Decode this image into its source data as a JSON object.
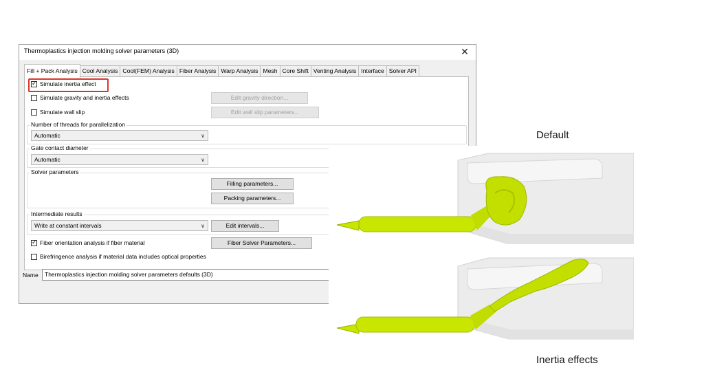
{
  "dialog": {
    "title": "Thermoplastics injection molding solver parameters (3D)",
    "close_glyph": "✕",
    "tabs": [
      "Fill + Pack Analysis",
      "Cool Analysis",
      "Cool(FEM) Analysis",
      "Fiber Analysis",
      "Warp Analysis",
      "Mesh",
      "Core Shift",
      "Venting Analysis",
      "Interface",
      "Solver API"
    ],
    "active_tab": "Fill + Pack Analysis",
    "checkboxes": {
      "inertia": {
        "label": "Simulate inertia effect",
        "checked": true
      },
      "gravity": {
        "label": "Simulate gravity and inertia effects",
        "checked": false
      },
      "wallslip": {
        "label": "Simulate wall slip",
        "checked": false
      },
      "fiber": {
        "label": "Fiber orientation analysis if fiber material",
        "checked": true
      },
      "birefringence": {
        "label": "Birefringence analysis if material data includes optical properties",
        "checked": false
      }
    },
    "buttons": {
      "gravity_dir": "Edit gravity direction...",
      "wall_slip": "Edit wall slip parameters...",
      "filling": "Filling parameters...",
      "packing": "Packing parameters...",
      "intervals": "Edit intervals...",
      "fiber_solver": "Fiber Solver Parameters..."
    },
    "groups": {
      "threads": {
        "label": "Number of threads for parallelization",
        "value": "Automatic"
      },
      "gate": {
        "label": "Gate contact diameter",
        "value": "Automatic"
      },
      "solver": {
        "label": "Solver parameters"
      },
      "intermediate": {
        "label": "Intermediate results",
        "value": "Write at constant intervals"
      }
    },
    "name": {
      "label": "Name",
      "value": "Thermoplastics injection molding solver parameters defaults (3D)"
    }
  },
  "captions": {
    "default": "Default",
    "inertia": "Inertia effects"
  },
  "colors": {
    "highlight": "#d9362b",
    "fill_green": "#c9e600"
  },
  "icons": {
    "check": "✓",
    "chevron": "∨"
  }
}
